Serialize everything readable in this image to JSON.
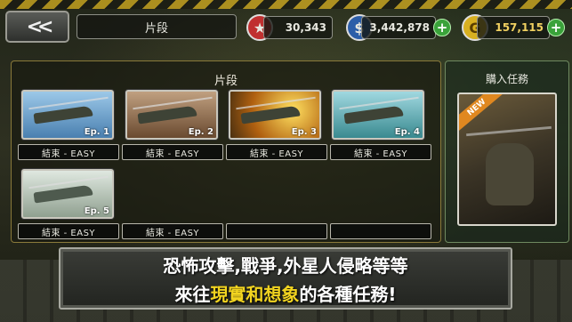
{
  "top_bar": {
    "back_label": "<<",
    "title": "片段",
    "stars": "30,343",
    "money": "3,442,878",
    "gold": "157,115",
    "plus_label": "+"
  },
  "icons": {
    "star": "star-icon",
    "dollar": "dollar-icon",
    "gold": "gold-coin-icon"
  },
  "symbols": {
    "star": "★",
    "dollar": "$",
    "gold": "G"
  },
  "panel": {
    "title": "片段",
    "episodes": [
      {
        "label": "Ep. 1",
        "difficulty": "結束 - EASY",
        "color": "#6aa0c8"
      },
      {
        "label": "Ep. 2",
        "difficulty": "結束 - EASY",
        "color": "#8a6a48"
      },
      {
        "label": "Ep. 3",
        "difficulty": "結束 - EASY",
        "color": "#c9a030"
      },
      {
        "label": "Ep. 4",
        "difficulty": "結束 - EASY",
        "color": "#4aa0a8"
      },
      {
        "label": "Ep. 5",
        "difficulty": "結束 - EASY",
        "color": "#b8c4b8"
      }
    ],
    "extra_difficulty": "結束 - EASY",
    "empty_slots": [
      "",
      ""
    ]
  },
  "side": {
    "title": "購入任務",
    "badge": "NEW"
  },
  "caption": {
    "line1": "恐怖攻擊,戰爭,外星人侵略等等",
    "line2_pre": "來往",
    "line2_highlight": "現實和想象",
    "line2_post": "的各種任務!"
  },
  "colors": {
    "accent_gold": "#f2d420",
    "plus_green": "#3aa23a",
    "star_red": "#c03030",
    "dollar_blue": "#2c5ea8",
    "gold_yellow": "#d8b020"
  }
}
